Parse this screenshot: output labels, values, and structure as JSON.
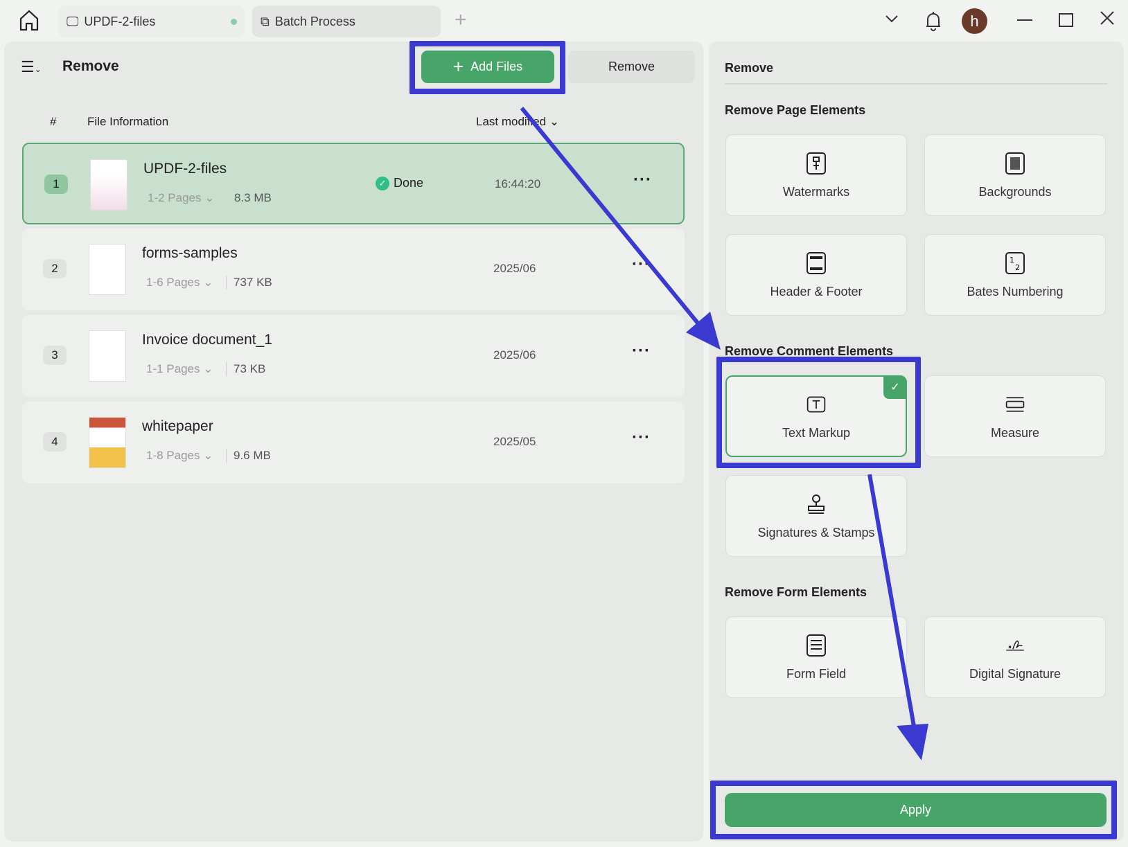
{
  "tabs": [
    {
      "label": "UPDF-2-files"
    },
    {
      "label": "Batch Process"
    }
  ],
  "avatar_letter": "h",
  "left": {
    "title": "Remove",
    "add_files": "Add Files",
    "remove": "Remove",
    "columns": {
      "num": "#",
      "info": "File Information",
      "modified": "Last modified"
    },
    "files": [
      {
        "n": "1",
        "name": "UPDF-2-files",
        "pages": "1-2 Pages",
        "size": "8.3 MB",
        "status": "Done",
        "date": "16:44:20"
      },
      {
        "n": "2",
        "name": "forms-samples",
        "pages": "1-6 Pages",
        "size": "737 KB",
        "date": "2025/06"
      },
      {
        "n": "3",
        "name": "Invoice document_1",
        "pages": "1-1 Pages",
        "size": "73 KB",
        "date": "2025/06"
      },
      {
        "n": "4",
        "name": "whitepaper",
        "pages": "1-8 Pages",
        "size": "9.6 MB",
        "date": "2025/05"
      }
    ]
  },
  "right": {
    "title": "Remove",
    "page_heading": "Remove Page Elements",
    "page_items": [
      "Watermarks",
      "Backgrounds",
      "Header & Footer",
      "Bates Numbering"
    ],
    "comment_heading": "Remove Comment Elements",
    "comment_items": [
      "Text Markup",
      "Measure",
      "Signatures & Stamps"
    ],
    "form_heading": "Remove Form Elements",
    "form_items": [
      "Form Field",
      "Digital Signature"
    ],
    "apply": "Apply"
  },
  "colors": {
    "accent": "#48a56a",
    "annotation": "#3b3ad0"
  }
}
